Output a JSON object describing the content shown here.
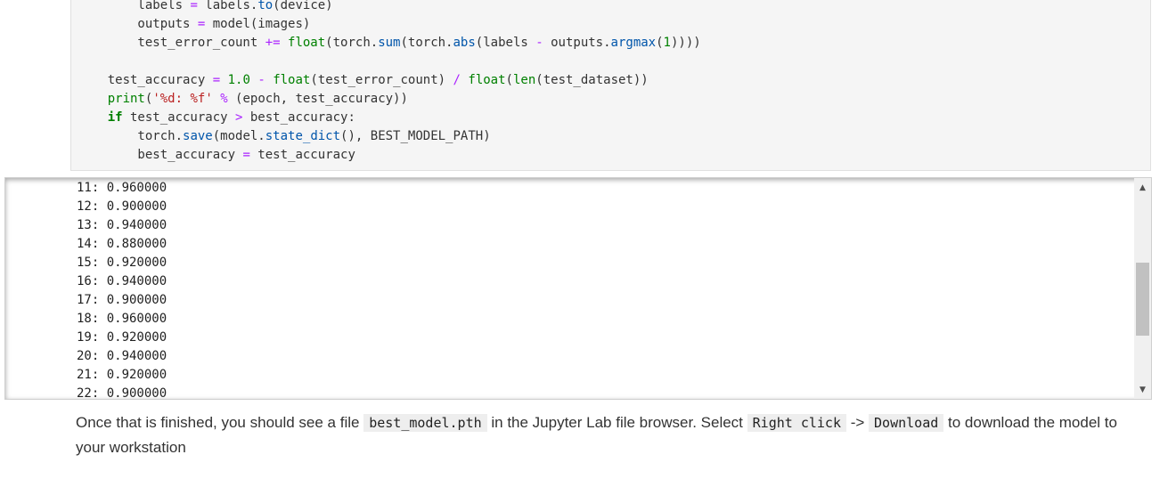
{
  "code_cell": {
    "lines": [
      [
        {
          "t": "        labels "
        },
        {
          "t": "=",
          "c": "op"
        },
        {
          "t": " labels."
        },
        {
          "t": "to",
          "c": "attr"
        },
        {
          "t": "(device)"
        }
      ],
      [
        {
          "t": "        outputs "
        },
        {
          "t": "=",
          "c": "op"
        },
        {
          "t": " model(images)"
        }
      ],
      [
        {
          "t": "        test_error_count "
        },
        {
          "t": "+=",
          "c": "op"
        },
        {
          "t": " "
        },
        {
          "t": "float",
          "c": "fn"
        },
        {
          "t": "(torch."
        },
        {
          "t": "sum",
          "c": "attr"
        },
        {
          "t": "(torch."
        },
        {
          "t": "abs",
          "c": "attr"
        },
        {
          "t": "(labels "
        },
        {
          "t": "-",
          "c": "op"
        },
        {
          "t": " outputs."
        },
        {
          "t": "argmax",
          "c": "attr"
        },
        {
          "t": "("
        },
        {
          "t": "1",
          "c": "num"
        },
        {
          "t": "))))"
        }
      ],
      [
        {
          "t": ""
        }
      ],
      [
        {
          "t": "    test_accuracy "
        },
        {
          "t": "=",
          "c": "op"
        },
        {
          "t": " "
        },
        {
          "t": "1.0",
          "c": "num"
        },
        {
          "t": " "
        },
        {
          "t": "-",
          "c": "op"
        },
        {
          "t": " "
        },
        {
          "t": "float",
          "c": "fn"
        },
        {
          "t": "(test_error_count) "
        },
        {
          "t": "/",
          "c": "op"
        },
        {
          "t": " "
        },
        {
          "t": "float",
          "c": "fn"
        },
        {
          "t": "("
        },
        {
          "t": "len",
          "c": "fn"
        },
        {
          "t": "(test_dataset))"
        }
      ],
      [
        {
          "t": "    "
        },
        {
          "t": "print",
          "c": "fn"
        },
        {
          "t": "("
        },
        {
          "t": "'%d: %f'",
          "c": "str"
        },
        {
          "t": " "
        },
        {
          "t": "%",
          "c": "op"
        },
        {
          "t": " (epoch, test_accuracy))"
        }
      ],
      [
        {
          "t": "    "
        },
        {
          "t": "if",
          "c": "kw"
        },
        {
          "t": " test_accuracy "
        },
        {
          "t": ">",
          "c": "op"
        },
        {
          "t": " best_accuracy:"
        }
      ],
      [
        {
          "t": "        torch."
        },
        {
          "t": "save",
          "c": "attr"
        },
        {
          "t": "(model."
        },
        {
          "t": "state_dict",
          "c": "attr"
        },
        {
          "t": "(), BEST_MODEL_PATH)"
        }
      ],
      [
        {
          "t": "        best_accuracy "
        },
        {
          "t": "=",
          "c": "op"
        },
        {
          "t": " test_accuracy"
        }
      ]
    ]
  },
  "output": {
    "lines": [
      "11: 0.960000",
      "12: 0.900000",
      "13: 0.940000",
      "14: 0.880000",
      "15: 0.920000",
      "16: 0.940000",
      "17: 0.900000",
      "18: 0.960000",
      "19: 0.920000",
      "20: 0.940000",
      "21: 0.920000",
      "22: 0.900000"
    ],
    "scroll_up_icon": "▲",
    "scroll_down_icon": "▼"
  },
  "markdown": {
    "text_1": "Once that is finished, you should see a file ",
    "code_1": "best_model.pth",
    "text_2": " in the Jupyter Lab file browser. Select ",
    "code_2": "Right click",
    "text_3": " -> ",
    "code_3": "Download",
    "text_4": " to download the model to your workstation"
  }
}
